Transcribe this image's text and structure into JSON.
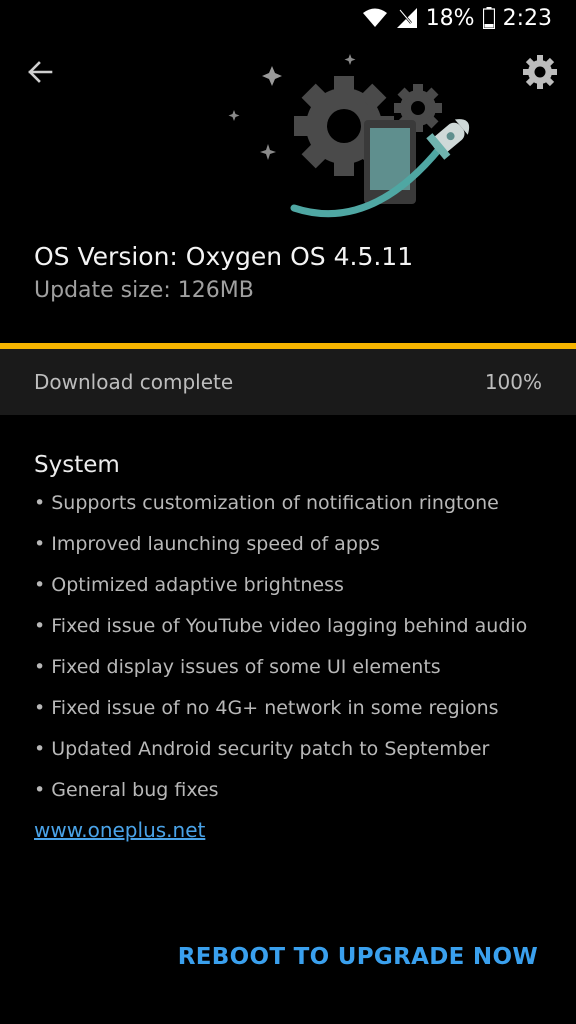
{
  "status_bar": {
    "battery": "18%",
    "time": "2:23",
    "icons": [
      "wifi-icon",
      "cell-signal-icon",
      "battery-icon"
    ]
  },
  "header": {
    "back_icon": "arrow-back-icon",
    "settings_icon": "gear-icon"
  },
  "update": {
    "os_version": "OS Version: Oxygen OS 4.5.11",
    "update_size": "Update size: 126MB"
  },
  "download": {
    "status": "Download complete",
    "percent_label": "100%",
    "progress": 1.0
  },
  "changelog": {
    "title": "System",
    "items": [
      "• Supports customization of notification ringtone",
      "• Improved launching speed of apps",
      "• Optimized adaptive brightness",
      "• Fixed issue of YouTube video lagging behind audio",
      "• Fixed display issues of some UI elements",
      "• Fixed issue of no 4G+ network in some regions",
      "• Updated Android security patch to September",
      "• General bug fixes"
    ],
    "link": "www.oneplus.net"
  },
  "actions": {
    "reboot": "REBOOT TO UPGRADE NOW"
  },
  "colors": {
    "background": "#000000",
    "accent_progress": "#f5b400",
    "link": "#4aa3e8",
    "button": "#3aa0ee"
  }
}
